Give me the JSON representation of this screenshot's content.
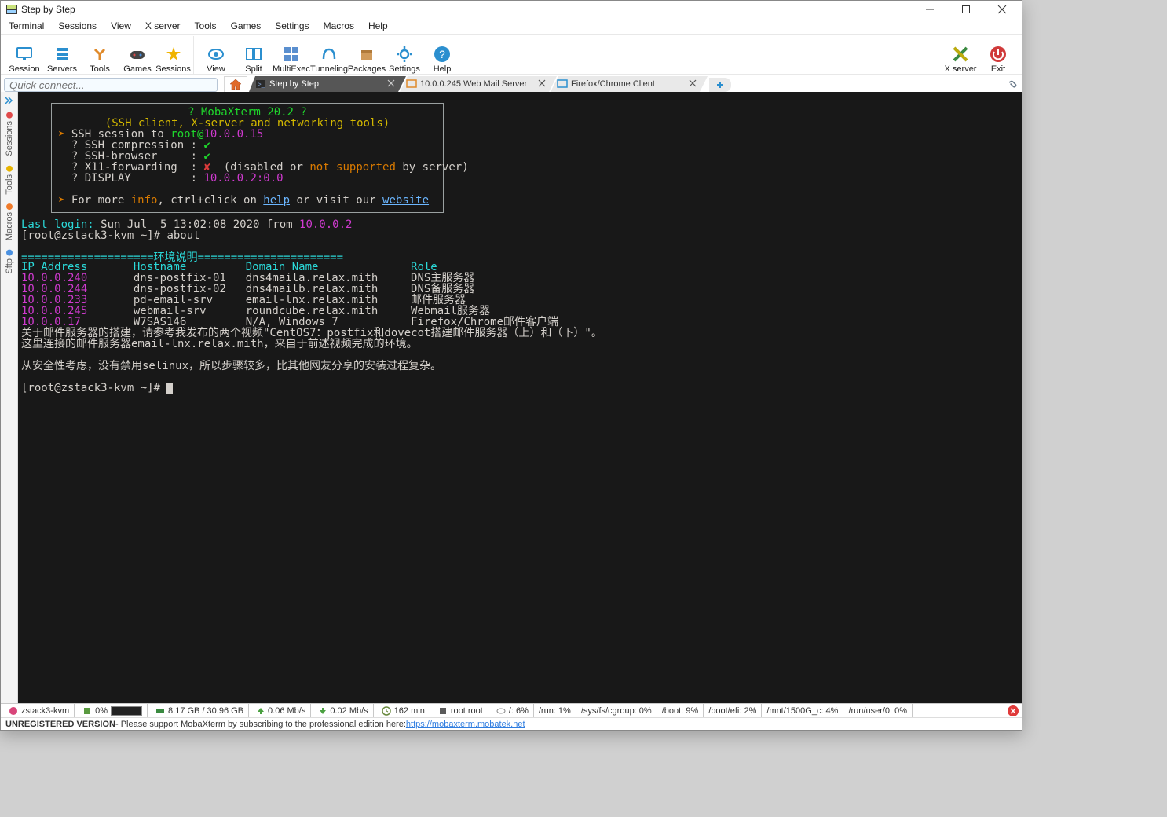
{
  "window": {
    "title": "Step by Step"
  },
  "menu": [
    "Terminal",
    "Sessions",
    "View",
    "X server",
    "Tools",
    "Games",
    "Settings",
    "Macros",
    "Help"
  ],
  "toolbar": {
    "items": [
      {
        "key": "session",
        "label": "Session",
        "icon": "monitor",
        "sep": false
      },
      {
        "key": "servers",
        "label": "Servers",
        "icon": "rack",
        "sep": false
      },
      {
        "key": "tools",
        "label": "Tools",
        "icon": "tools",
        "sep": false
      },
      {
        "key": "games",
        "label": "Games",
        "icon": "gamepad",
        "sep": false
      },
      {
        "key": "sessions",
        "label": "Sessions",
        "icon": "star",
        "sep": true
      },
      {
        "key": "view",
        "label": "View",
        "icon": "eye",
        "sep": false
      },
      {
        "key": "split",
        "label": "Split",
        "icon": "split",
        "sep": false
      },
      {
        "key": "multiexec",
        "label": "MultiExec",
        "icon": "multiexec",
        "sep": false
      },
      {
        "key": "tunneling",
        "label": "Tunneling",
        "icon": "tunnel",
        "sep": false
      },
      {
        "key": "packages",
        "label": "Packages",
        "icon": "package",
        "sep": false
      },
      {
        "key": "settings",
        "label": "Settings",
        "icon": "gear",
        "sep": false
      },
      {
        "key": "help",
        "label": "Help",
        "icon": "help",
        "sep": false
      }
    ],
    "right": [
      {
        "key": "xserver",
        "label": "X server",
        "icon": "xserver"
      },
      {
        "key": "exit",
        "label": "Exit",
        "icon": "exit"
      }
    ]
  },
  "quick_connect_placeholder": "Quick connect...",
  "tabs": [
    {
      "key": "home",
      "kind": "home"
    },
    {
      "key": "step",
      "kind": "dark",
      "label": "Step by Step",
      "icon": "terminal"
    },
    {
      "key": "mail",
      "kind": "light",
      "label": "10.0.0.245 Web Mail Server",
      "icon": "monitor-orange"
    },
    {
      "key": "ffchrome",
      "kind": "light",
      "label": "Firefox/Chrome Client",
      "icon": "monitor-blue"
    }
  ],
  "sidebar": [
    {
      "key": "sessions",
      "label": "Sessions",
      "color": "red"
    },
    {
      "key": "tools",
      "label": "Tools",
      "color": "gold"
    },
    {
      "key": "macros",
      "label": "Macros",
      "color": "orange"
    },
    {
      "key": "sftp",
      "label": "Sftp",
      "color": "blue"
    }
  ],
  "terminal": {
    "banner_title_q": "? ",
    "banner_title": "MobaXterm 20.2",
    "banner_title_q2": " ?",
    "banner_sub": "(SSH client, X-server and networking tools)",
    "ssh_line_prefix": "SSH session to ",
    "ssh_user": "root@",
    "ssh_host": "10.0.0.15",
    "ssh_comp_label": "? SSH compression : ",
    "ssh_browser_label": "? SSH-browser     : ",
    "x11_label": "? X11-forwarding  : ",
    "x11_off": "✘  ",
    "x11_mid1": "(disabled ",
    "x11_mid2": "or ",
    "x11_not": "not supported ",
    "x11_tail": "by server)",
    "display_label": "? DISPLAY         : ",
    "display_val": "10.0.0.2:0.0",
    "more_a": "For more ",
    "more_info": "info",
    "more_b": ", ctrl+click on ",
    "more_help": "help",
    "more_c": " or visit our ",
    "more_site": "website",
    "last_login_a": "Last login:",
    "last_login_b": " Sun Jul  5 13:02:08 2020 from ",
    "last_login_ip": "10.0.0.2",
    "prompt1": "[root@zstack3-kvm ~]# ",
    "cmd1": "about",
    "env_divider": "====================环境说明======================",
    "env_headers": [
      "IP Address",
      "Hostname",
      "Domain Name",
      "Role"
    ],
    "env_rows": [
      {
        "ip": "10.0.0.240",
        "host": "dns-postfix-01",
        "domain": "dns4maila.relax.mith",
        "role": "DNS主服务器"
      },
      {
        "ip": "10.0.0.244",
        "host": "dns-postfix-02",
        "domain": "dns4mailb.relax.mith",
        "role": "DNS备服务器"
      },
      {
        "ip": "10.0.0.233",
        "host": "pd-email-srv",
        "domain": "email-lnx.relax.mith",
        "role": "邮件服务器"
      },
      {
        "ip": "10.0.0.245",
        "host": "webmail-srv",
        "domain": "roundcube.relax.mith",
        "role": "Webmail服务器"
      },
      {
        "ip": "10.0.0.17",
        "host": "W7SAS146",
        "domain": "N/A, Windows 7",
        "role": "Firefox/Chrome邮件客户端"
      }
    ],
    "note1": "关于邮件服务器的搭建，请参考我发布的两个视频\"CentOS7：postfix和dovecot搭建邮件服务器（上）和（下）\"。",
    "note2": "这里连接的邮件服务器email-lnx.relax.mith，来自于前述视频完成的环境。",
    "note3": "从安全性考虑，没有禁用selinux，所以步骤较多，比其他网友分享的安装过程复杂。",
    "prompt2": "[root@zstack3-kvm ~]# "
  },
  "status": {
    "host": "zstack3-kvm",
    "cpu_pct": "0%",
    "ram": "8.17 GB / 30.96 GB",
    "up": "0.06 Mb/s",
    "down": "0.02 Mb/s",
    "uptime": "162 min",
    "user": "root root",
    "disks": [
      "/: 6%",
      "/run: 1%",
      "/sys/fs/cgroup: 0%",
      "/boot: 9%",
      "/boot/efi: 2%",
      "/mnt/1500G_c: 4%",
      "/run/user/0: 0%"
    ]
  },
  "regbar": {
    "bold": "UNREGISTERED VERSION",
    "text": " -  Please support MobaXterm by subscribing to the professional edition here: ",
    "link": "https://mobaxterm.mobatek.net"
  }
}
